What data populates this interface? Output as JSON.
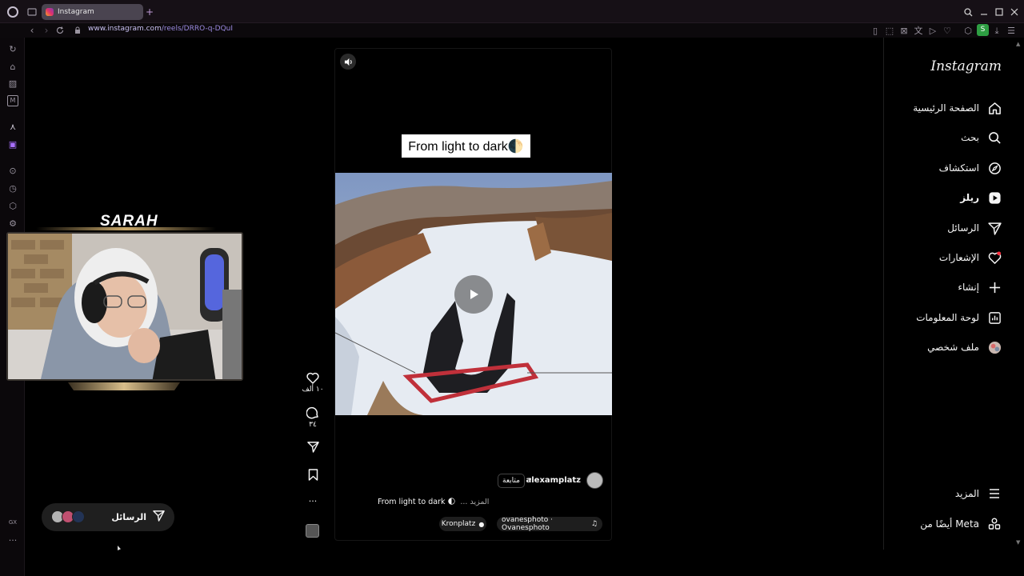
{
  "browser": {
    "tab_title": "Instagram",
    "new_tab": "+",
    "url_domain": "www.instagram.com",
    "url_path": "/reels/DRRO-q-DQuI",
    "sidebar_bottom_label": "GX",
    "more": "···",
    "profile_initial": "S"
  },
  "stream": {
    "overlay_name": "SARAH"
  },
  "reel": {
    "caption_overlay": "From light to dark🌓",
    "likes": "١٠ ألف",
    "comments": "٣٤",
    "username": "alexamplatz",
    "follow_label": "متابعة",
    "separator": "•",
    "description": "From light to dark 🌓",
    "more_label": "... المزيد",
    "location": "Kronplatz",
    "audio": "ovanesphoto · Ovanesphoto",
    "actions_more": "···"
  },
  "instagram": {
    "logo": "Instagram",
    "nav": [
      {
        "label": "الصفحة الرئيسية",
        "icon": "home-icon"
      },
      {
        "label": "بحث",
        "icon": "search-icon"
      },
      {
        "label": "استكشاف",
        "icon": "compass-icon"
      },
      {
        "label": "ريلز",
        "icon": "reels-icon"
      },
      {
        "label": "الرسائل",
        "icon": "messages-icon"
      },
      {
        "label": "الإشعارات",
        "icon": "heart-icon"
      },
      {
        "label": "إنشاء",
        "icon": "plus-icon"
      },
      {
        "label": "لوحة المعلومات",
        "icon": "dashboard-icon"
      },
      {
        "label": "ملف شخصي",
        "icon": "avatar-icon"
      }
    ],
    "more_label": "المزيد",
    "meta_label": "أيضًا من Meta",
    "messages_pill": "الرسائل"
  },
  "colors": {
    "url_accent": "#9b8ae0",
    "notification_dot": "#ff3040",
    "profile_badge": "#2e9e43"
  }
}
